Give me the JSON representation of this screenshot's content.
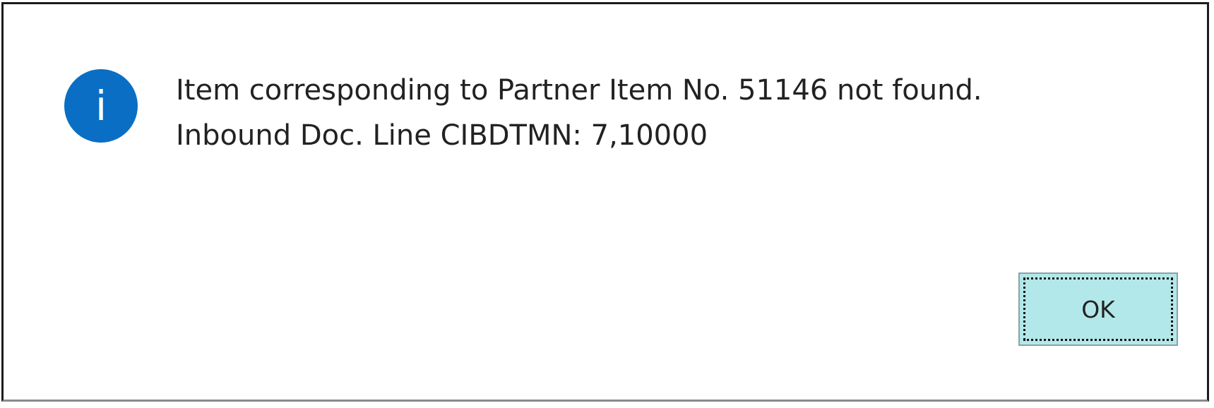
{
  "dialog": {
    "icon": "info-icon",
    "icon_glyph": "i",
    "icon_color": "#0a6fc4",
    "message_line1": "Item corresponding to Partner Item No. 51146 not found.",
    "message_line2": "Inbound Doc. Line CIBDTMN: 7,10000",
    "ok_label": "OK",
    "button_color": "#b3e8ea"
  }
}
